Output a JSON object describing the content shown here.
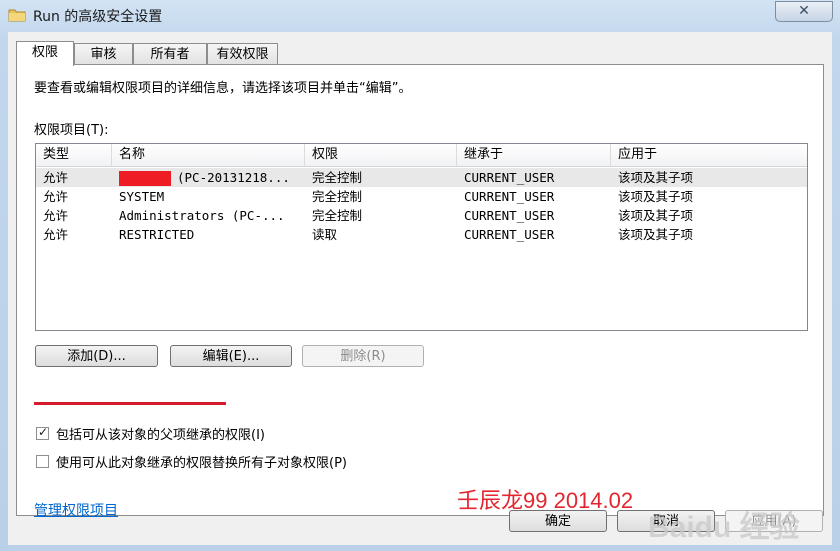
{
  "window": {
    "title": "Run 的高级安全设置",
    "close_label": "✕"
  },
  "tabs": [
    {
      "label": "权限",
      "active": true
    },
    {
      "label": "审核"
    },
    {
      "label": "所有者"
    },
    {
      "label": "有效权限"
    }
  ],
  "panel": {
    "description": "要查看或编辑权限项目的详细信息，请选择该项目并单击“编辑”。",
    "list_label": "权限项目(T):"
  },
  "columns": [
    "类型",
    "名称",
    "权限",
    "继承于",
    "应用于"
  ],
  "rows": [
    {
      "type": "允许",
      "name": "(PC-20131218...",
      "permission": "完全控制",
      "inherited": "CURRENT_USER",
      "applies": "该项及其子项",
      "redacted": true
    },
    {
      "type": "允许",
      "name": "SYSTEM",
      "permission": "完全控制",
      "inherited": "CURRENT_USER",
      "applies": "该项及其子项"
    },
    {
      "type": "允许",
      "name": "Administrators (PC-...",
      "permission": "完全控制",
      "inherited": "CURRENT_USER",
      "applies": "该项及其子项"
    },
    {
      "type": "允许",
      "name": "RESTRICTED",
      "permission": "读取",
      "inherited": "CURRENT_USER",
      "applies": "该项及其子项"
    }
  ],
  "buttons": {
    "add": "添加(D)...",
    "edit": "编辑(E)...",
    "remove": "删除(R)"
  },
  "checkboxes": [
    {
      "label": "包括可从该对象的父项继承的权限(I)",
      "checked": true
    },
    {
      "label": "使用可从此对象继承的权限替换所有子对象权限(P)",
      "checked": false
    }
  ],
  "link": "管理权限项目",
  "watermark": "壬辰龙99 2014.02",
  "baidu_watermark": "Baidu 经验",
  "footer": {
    "ok": "确定",
    "cancel": "取消",
    "apply": "应用(A)"
  },
  "colors": {
    "highlight": "#ee1c24",
    "link": "#0066cc"
  }
}
